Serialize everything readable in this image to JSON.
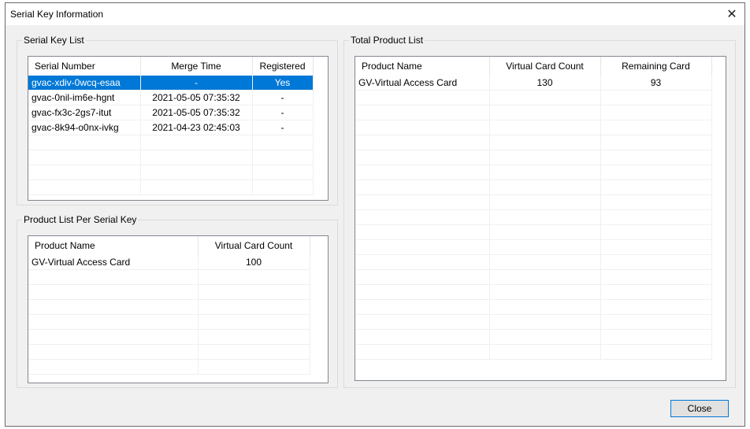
{
  "window": {
    "title": "Serial Key Information",
    "close_glyph": "✕"
  },
  "serial_key_list": {
    "label": "Serial Key List",
    "columns": [
      "Serial Number",
      "Merge Time",
      "Registered"
    ],
    "rows": [
      [
        "gvac-xdiv-0wcq-esaa",
        "-",
        "Yes"
      ],
      [
        "gvac-0nil-im6e-hgnt",
        "2021-05-05 07:35:32",
        "-"
      ],
      [
        "gvac-fx3c-2gs7-itut",
        "2021-05-05 07:35:32",
        "-"
      ],
      [
        "gvac-8k94-o0nx-ivkg",
        "2021-04-23 02:45:03",
        "-"
      ]
    ],
    "selected_row": 0
  },
  "product_list_per_serial": {
    "label": "Product List Per Serial Key",
    "columns": [
      "Product Name",
      "Virtual Card Count"
    ],
    "rows": [
      [
        "GV-Virtual Access Card",
        "100"
      ]
    ]
  },
  "total_product_list": {
    "label": "Total Product List",
    "columns": [
      "Product Name",
      "Virtual Card Count",
      "Remaining Card"
    ],
    "rows": [
      [
        "GV-Virtual Access Card",
        "130",
        "93"
      ]
    ]
  },
  "buttons": {
    "close_label": "Close"
  },
  "colors": {
    "selection": "#0078d7",
    "window_bg": "#f0f0f0"
  }
}
